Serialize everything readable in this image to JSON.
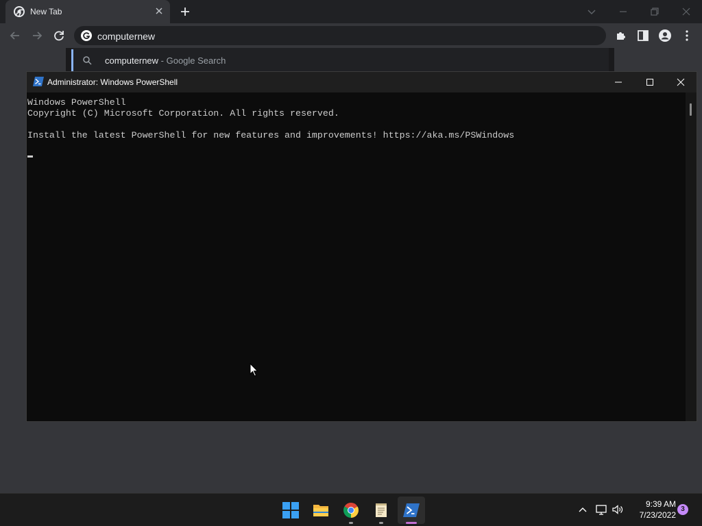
{
  "browser": {
    "tab": {
      "title": "New Tab",
      "favicon": "chrome-icon"
    },
    "omnibox": {
      "value": "computernew"
    },
    "suggestion": {
      "query": "computernew",
      "suffix": " - Google Search"
    }
  },
  "powershell": {
    "title": "Administrator: Windows PowerShell",
    "lines": [
      "Windows PowerShell",
      "Copyright (C) Microsoft Corporation. All rights reserved.",
      "",
      "Install the latest PowerShell for new features and improvements! https://aka.ms/PSWindows"
    ]
  },
  "taskbar": {
    "apps": [
      {
        "name": "start-button",
        "icon": "windows-logo-icon"
      },
      {
        "name": "file-explorer-app",
        "icon": "folder-icon"
      },
      {
        "name": "chrome-app",
        "icon": "chrome-icon"
      },
      {
        "name": "notepad-app",
        "icon": "notepad-icon"
      },
      {
        "name": "powershell-app",
        "icon": "powershell-icon",
        "active": true
      }
    ],
    "clock": {
      "time": "9:39 AM",
      "date": "7/23/2022"
    },
    "notifications": "3"
  },
  "colors": {
    "chrome_frame": "#202124",
    "chrome_toolbar": "#35363a",
    "console_bg": "#0c0c0c",
    "console_text": "#cccccc",
    "taskbar_bg": "#1c1c1c",
    "accent_blue": "#8ab4f8",
    "powershell_indicator": "#c36fd3"
  }
}
